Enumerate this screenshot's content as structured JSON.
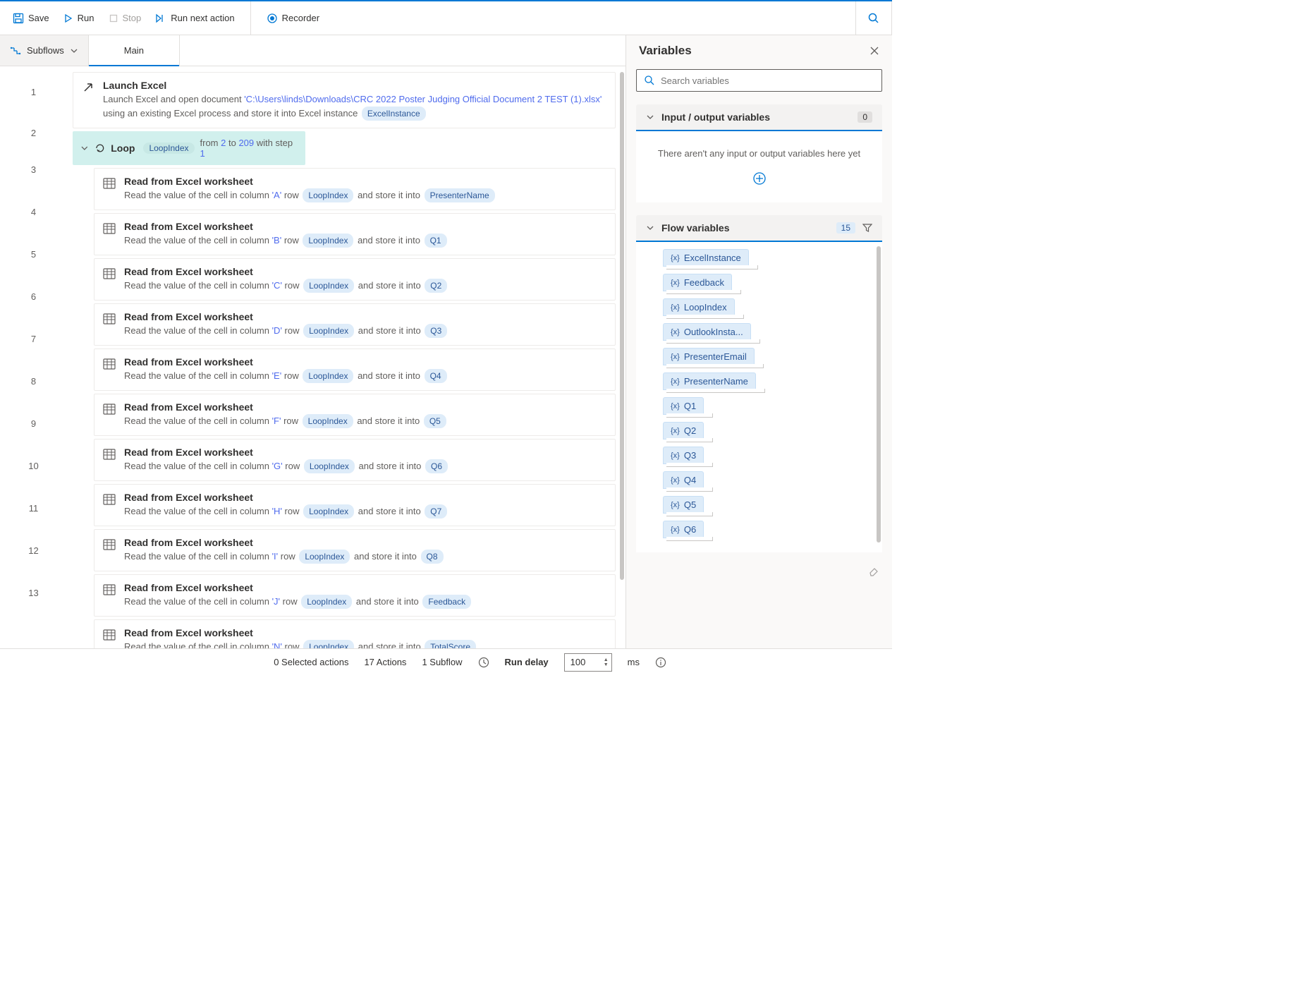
{
  "toolbar": {
    "save": "Save",
    "run": "Run",
    "stop": "Stop",
    "runNext": "Run next action",
    "recorder": "Recorder"
  },
  "tabs": {
    "subflows": "Subflows",
    "main": "Main"
  },
  "actions": [
    {
      "num": "1",
      "icon": "arrow",
      "title": "Launch Excel",
      "descPre": "Launch Excel and open document ",
      "lit1": "'C:\\Users\\linds\\Downloads\\CRC 2022 Poster Judging Official Document 2 TEST (1).xlsx'",
      "descMid": " using an existing Excel process and store it into Excel instance ",
      "pill": "ExcelInstance"
    },
    {
      "num": "2",
      "icon": "loop",
      "loop": true,
      "title": "Loop",
      "var": "LoopIndex",
      "from": "2",
      "to": "209",
      "step": "1"
    },
    {
      "num": "3",
      "icon": "excel",
      "title": "Read from Excel worksheet",
      "col": "'A'",
      "storeVar": "PresenterName"
    },
    {
      "num": "4",
      "icon": "excel",
      "title": "Read from Excel worksheet",
      "col": "'B'",
      "storeVar": "Q1"
    },
    {
      "num": "5",
      "icon": "excel",
      "title": "Read from Excel worksheet",
      "col": "'C'",
      "storeVar": "Q2"
    },
    {
      "num": "6",
      "icon": "excel",
      "title": "Read from Excel worksheet",
      "col": "'D'",
      "storeVar": "Q3"
    },
    {
      "num": "7",
      "icon": "excel",
      "title": "Read from Excel worksheet",
      "col": "'E'",
      "storeVar": "Q4"
    },
    {
      "num": "8",
      "icon": "excel",
      "title": "Read from Excel worksheet",
      "col": "'F'",
      "storeVar": "Q5"
    },
    {
      "num": "9",
      "icon": "excel",
      "title": "Read from Excel worksheet",
      "col": "'G'",
      "storeVar": "Q6"
    },
    {
      "num": "10",
      "icon": "excel",
      "title": "Read from Excel worksheet",
      "col": "'H'",
      "storeVar": "Q7"
    },
    {
      "num": "11",
      "icon": "excel",
      "title": "Read from Excel worksheet",
      "col": "'I'",
      "storeVar": "Q8"
    },
    {
      "num": "12",
      "icon": "excel",
      "title": "Read from Excel worksheet",
      "col": "'J'",
      "storeVar": "Feedback"
    },
    {
      "num": "13",
      "icon": "excel",
      "title": "Read from Excel worksheet",
      "col": "'N'",
      "storeVar": "TotalScore"
    }
  ],
  "readTemplate": {
    "pre": "Read the value of the cell in column ",
    "row": " row ",
    "rowVar": "LoopIndex",
    "store": " and store it into "
  },
  "loopText": {
    "fromLabel": "from ",
    "toLabel": " to ",
    "stepLabel": " with step "
  },
  "varsPanel": {
    "title": "Variables",
    "searchPlaceholder": "Search variables",
    "io": {
      "title": "Input / output variables",
      "count": "0",
      "empty": "There aren't any input or output variables here yet"
    },
    "flow": {
      "title": "Flow variables",
      "count": "15"
    },
    "flowVars": [
      "ExcelInstance",
      "Feedback",
      "LoopIndex",
      "OutlookInsta...",
      "PresenterEmail",
      "PresenterName",
      "Q1",
      "Q2",
      "Q3",
      "Q4",
      "Q5",
      "Q6"
    ]
  },
  "status": {
    "selected": "0 Selected actions",
    "actions": "17 Actions",
    "subflows": "1 Subflow",
    "runDelay": "Run delay",
    "delayValue": "100",
    "ms": "ms"
  }
}
